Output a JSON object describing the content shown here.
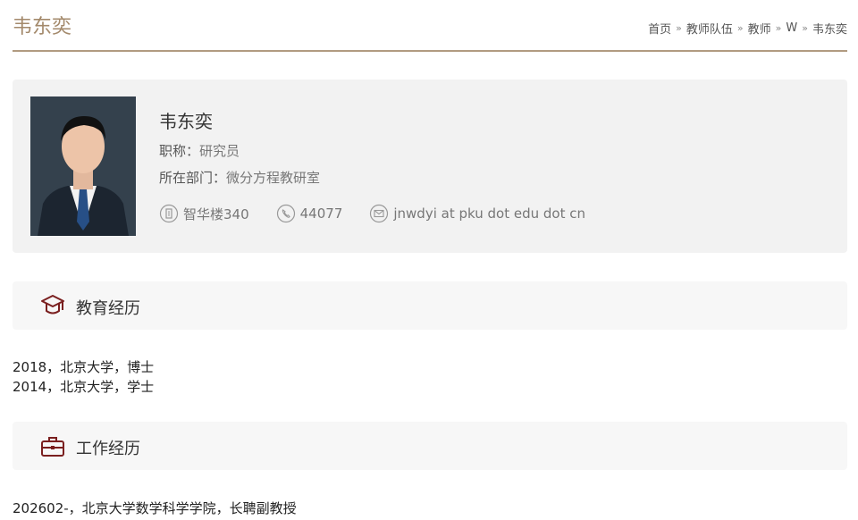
{
  "page": {
    "title": "韦东奕",
    "breadcrumb": [
      {
        "label": "首页"
      },
      {
        "label": "教师队伍"
      },
      {
        "label": "教师"
      },
      {
        "label": "W"
      },
      {
        "label": "韦东奕"
      }
    ],
    "breadcrumb_sep": "»"
  },
  "profile": {
    "name": "韦东奕",
    "title_label": "职称：",
    "title_value": "研究员",
    "dept_label": "所在部门：",
    "dept_value": "微分方程教研室",
    "office": {
      "icon": "building-icon",
      "text": "智华楼340"
    },
    "phone": {
      "icon": "phone-icon",
      "text": "44077"
    },
    "email": {
      "icon": "mail-icon",
      "text": "jnwdyi at pku dot edu dot cn"
    }
  },
  "education": {
    "heading": "教育经历",
    "icon": "graduation-cap-icon",
    "items": [
      "2018，北京大学，博士",
      "2014，北京大学，学士"
    ]
  },
  "work": {
    "heading": "工作经历",
    "icon": "briefcase-icon",
    "items": [
      "202602-，北京大学数学科学学院，长聘副教授"
    ]
  },
  "colors": {
    "accent": "#a3896b",
    "icon_dark": "#7a1f1f",
    "card_bg": "#f2f2f2"
  }
}
